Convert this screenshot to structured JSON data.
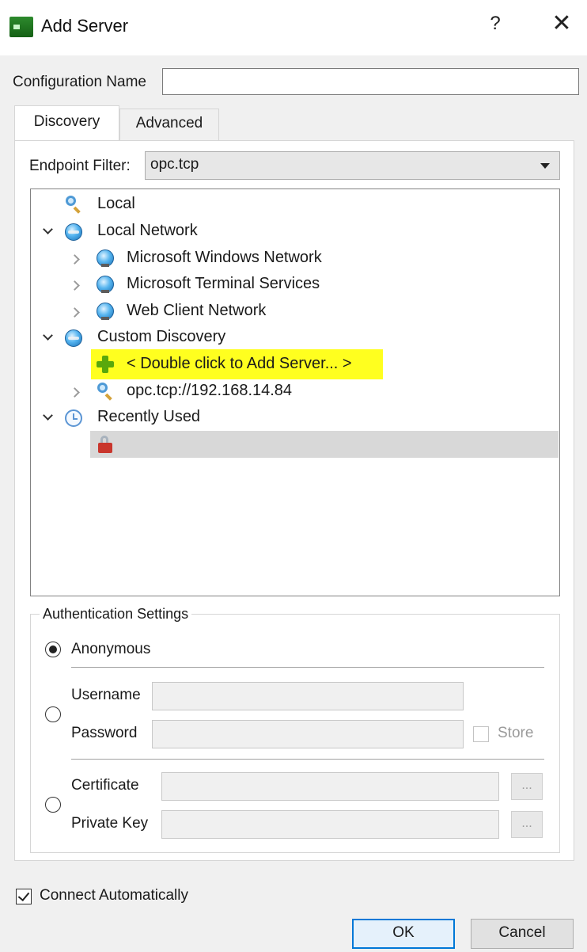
{
  "window": {
    "title": "Add Server",
    "help_label": "?",
    "close_label": "✕"
  },
  "config": {
    "label": "Configuration Name",
    "value": ""
  },
  "tabs": [
    {
      "label": "Discovery",
      "active": true
    },
    {
      "label": "Advanced",
      "active": false
    }
  ],
  "endpoint_filter": {
    "label": "Endpoint Filter:",
    "value": "opc.tcp"
  },
  "tree": {
    "local": {
      "label": "Local",
      "icon": "search-icon"
    },
    "local_network": {
      "label": "Local Network",
      "icon": "globe-icon",
      "expanded": true,
      "children": [
        {
          "label": "Microsoft Windows Network",
          "icon": "network-computer-icon"
        },
        {
          "label": "Microsoft Terminal Services",
          "icon": "network-computer-icon"
        },
        {
          "label": "Web Client Network",
          "icon": "network-computer-icon"
        }
      ]
    },
    "custom_discovery": {
      "label": "Custom Discovery",
      "icon": "globe-icon",
      "expanded": true,
      "add_server": "< Double click to Add Server... >",
      "add_icon": "plus-icon",
      "endpoint": "opc.tcp://192.168.14.84",
      "endpoint_icon": "search-icon",
      "highlight_color": "#ffff1f"
    },
    "recently_used": {
      "label": "Recently Used",
      "icon": "clock-icon",
      "expanded": true,
      "item_icon": "lock-icon"
    }
  },
  "auth": {
    "legend": "Authentication Settings",
    "anonymous": "Anonymous",
    "username_label": "Username",
    "password_label": "Password",
    "store_label": "Store",
    "certificate_label": "Certificate",
    "private_key_label": "Private Key",
    "browse_label": "...",
    "selected": "anonymous"
  },
  "connect_auto": {
    "label": "Connect Automatically",
    "checked": true
  },
  "buttons": {
    "ok": "OK",
    "cancel": "Cancel"
  },
  "colors": {
    "accent": "#0078d7",
    "dialog_bg": "#f0f0f0"
  }
}
